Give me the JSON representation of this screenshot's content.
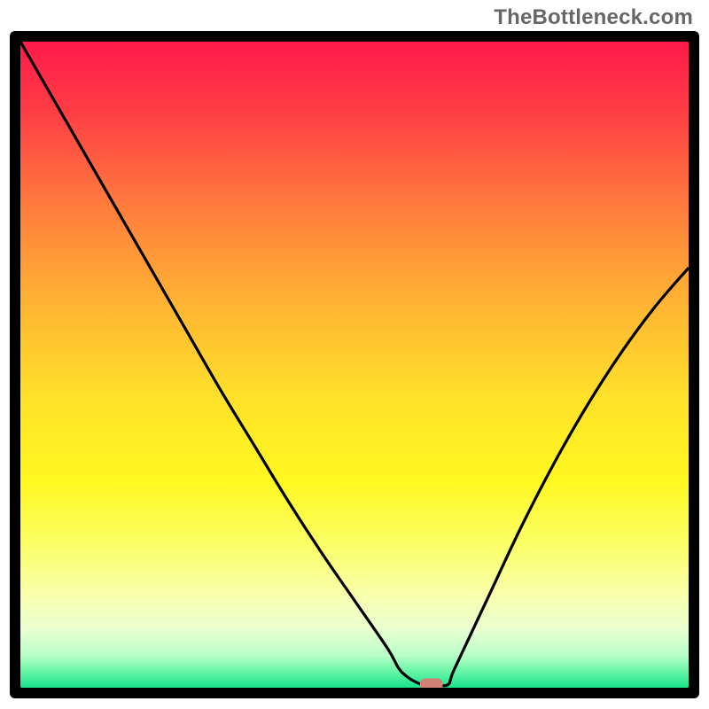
{
  "attribution": "TheBottleneck.com",
  "chart_data": {
    "type": "line",
    "title": "",
    "xlabel": "",
    "ylabel": "",
    "xlim": [
      0,
      100
    ],
    "ylim": [
      0,
      100
    ],
    "series": [
      {
        "name": "bottleneck-curve",
        "x": [
          0,
          5,
          10,
          15,
          20,
          25,
          30,
          35,
          40,
          45,
          50,
          55,
          57,
          60,
          62,
          64,
          65,
          70,
          75,
          80,
          85,
          90,
          95,
          100
        ],
        "y": [
          100,
          91,
          82,
          73,
          64,
          55,
          46,
          37.5,
          29,
          21,
          13.5,
          6,
          2.5,
          0.5,
          0.5,
          0.5,
          3,
          14,
          25,
          35,
          44,
          52,
          59,
          65
        ]
      }
    ],
    "marker": {
      "name": "optimal-point",
      "x": 61.5,
      "y": 0.5
    },
    "background_gradient": {
      "stops": [
        {
          "offset": 0.0,
          "color": "#ff1a4a"
        },
        {
          "offset": 0.1,
          "color": "#ff3a45"
        },
        {
          "offset": 0.25,
          "color": "#ff7a3d"
        },
        {
          "offset": 0.4,
          "color": "#ffb233"
        },
        {
          "offset": 0.55,
          "color": "#ffe12a"
        },
        {
          "offset": 0.68,
          "color": "#fff820"
        },
        {
          "offset": 0.78,
          "color": "#fbff68"
        },
        {
          "offset": 0.86,
          "color": "#f7ffb0"
        },
        {
          "offset": 0.91,
          "color": "#e8ffd0"
        },
        {
          "offset": 0.95,
          "color": "#b9ffc8"
        },
        {
          "offset": 0.975,
          "color": "#68f5a8"
        },
        {
          "offset": 1.0,
          "color": "#17e38b"
        }
      ]
    }
  }
}
